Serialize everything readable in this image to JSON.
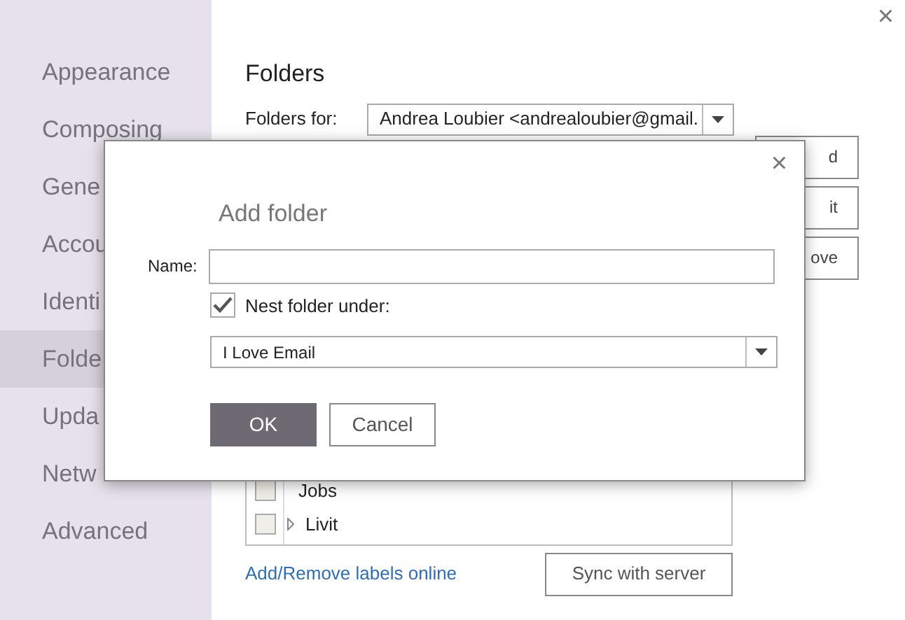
{
  "window": {
    "close": "×"
  },
  "sidebar": {
    "items": [
      {
        "label": "Appearance",
        "selected": false
      },
      {
        "label": "Composing",
        "selected": false
      },
      {
        "label": "Gene",
        "selected": false
      },
      {
        "label": "Accou",
        "selected": false
      },
      {
        "label": "Identi",
        "selected": false
      },
      {
        "label": "Folde",
        "selected": true
      },
      {
        "label": "Upda",
        "selected": false
      },
      {
        "label": "Netw",
        "selected": false
      },
      {
        "label": "Advanced",
        "selected": false
      }
    ]
  },
  "folders": {
    "title": "Folders",
    "account_label": "Folders for:",
    "account_value": "Andrea Loubier <andrealoubier@gmail.",
    "buttons": [
      "d",
      "it",
      "ove"
    ],
    "list": [
      {
        "label": "Jobs",
        "checked": false,
        "expandable": false
      },
      {
        "label": "Livit",
        "checked": false,
        "expandable": true
      }
    ],
    "link": "Add/Remove labels online",
    "sync_button": "Sync with server"
  },
  "dialog": {
    "close": "×",
    "title": "Add folder",
    "name_label": "Name:",
    "nest_checked": true,
    "nest_label": "Nest folder under:",
    "parent_value": "I Love Email",
    "ok": "OK",
    "cancel": "Cancel"
  }
}
